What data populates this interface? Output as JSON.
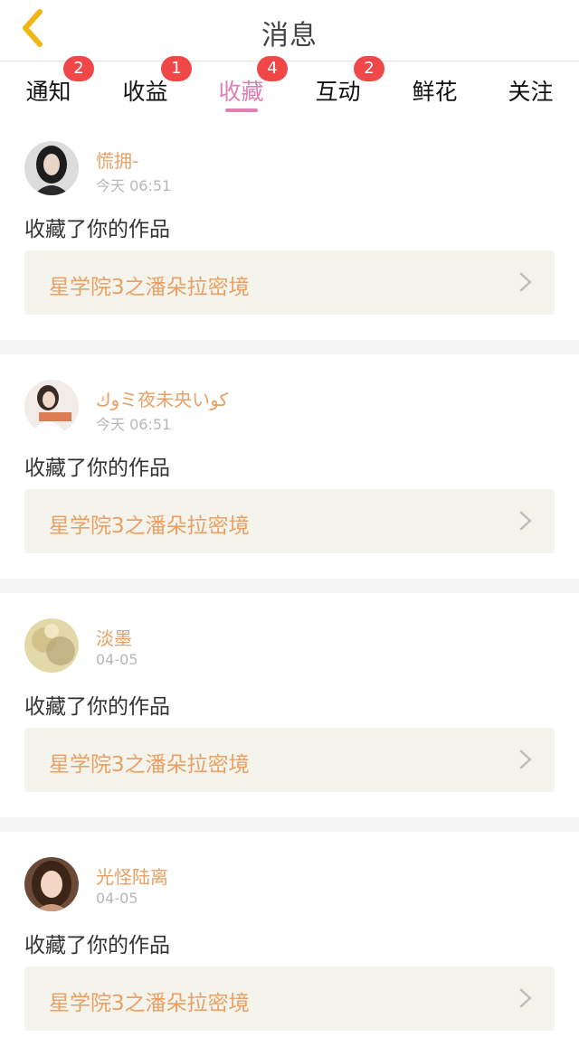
{
  "header": {
    "title": "消息",
    "back_icon": "chevron-left-icon",
    "back_color": "#f2b516"
  },
  "tabs": [
    {
      "label": "通知",
      "badge": "2"
    },
    {
      "label": "收益",
      "badge": "1"
    },
    {
      "label": "收藏",
      "badge": "4",
      "active": true
    },
    {
      "label": "互动",
      "badge": "2"
    },
    {
      "label": "鲜花",
      "badge": ""
    },
    {
      "label": "关注",
      "badge": ""
    }
  ],
  "colors": {
    "accent": "#e07fb4",
    "badge": "#f04848",
    "username": "#e8a064",
    "work_title": "#e8a064",
    "card_link_bg": "#f4f3ec",
    "gap_bg": "#f5f5f5"
  },
  "feed": [
    {
      "username": "慌拥-",
      "time": "今天 06:51",
      "action": "收藏了你的作品",
      "work_title": "星学院3之潘朵拉密境"
    },
    {
      "username": "وكミ夜未央いكو",
      "time": "今天 06:51",
      "action": "收藏了你的作品",
      "work_title": "星学院3之潘朵拉密境"
    },
    {
      "username": "淡墨",
      "time": "04-05",
      "action": "收藏了你的作品",
      "work_title": "星学院3之潘朵拉密境"
    },
    {
      "username": "光怪陆离",
      "time": "04-05",
      "action": "收藏了你的作品",
      "work_title": "星学院3之潘朵拉密境"
    }
  ]
}
